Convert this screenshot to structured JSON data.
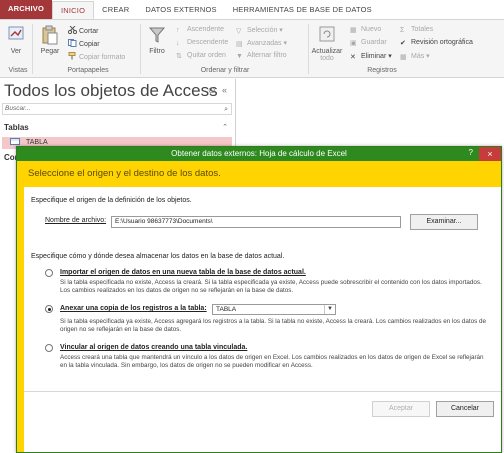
{
  "ribbon_tabs": [
    "ARCHIVO",
    "INICIO",
    "CREAR",
    "DATOS EXTERNOS",
    "HERRAMIENTAS DE BASE DE DATOS"
  ],
  "ribbon": {
    "ver": "Ver",
    "pegar": "Pegar",
    "cortar": "Cortar",
    "copiar": "Copiar",
    "copiar_formato": "Copiar formato",
    "filtro": "Filtro",
    "ascendente": "Ascendente",
    "descendente": "Descendente",
    "quitar_orden": "Quitar orden",
    "seleccion": "Selección",
    "avanzadas": "Avanzadas",
    "alternar_filtro": "Alternar filtro",
    "actualizar": "Actualizar",
    "todo": "todo",
    "nuevo": "Nuevo",
    "guardar": "Guardar",
    "eliminar": "Eliminar",
    "totales": "Totales",
    "revision": "Revisión ortográfica",
    "mas": "Más",
    "groups": [
      "Vistas",
      "Portapapeles",
      "Ordenar y filtrar",
      "Registros"
    ]
  },
  "nav": {
    "title": "Todos los objetos de Access",
    "search_placeholder": "Buscar...",
    "group_tablas": "Tablas",
    "item_tabla": "TABLA",
    "group_consultas": "Consultas"
  },
  "dialog": {
    "title": "Obtener datos externos: Hoja de cálculo de Excel",
    "help": "?",
    "close": "×",
    "header": "Seleccione el origen y el destino de los datos.",
    "specify_source": "Especifique el origen de la definición de los objetos.",
    "file_label": "Nombre de archivo:",
    "file_value": "E:\\Usuario 98637773\\Documents\\",
    "browse": "Examinar...",
    "specify_store": "Especifique cómo y dónde desea almacenar los datos en la base de datos actual.",
    "opt1_label": "Importar el origen de datos en una nueva tabla de la base de datos actual.",
    "opt1_desc": "Si la tabla especificada no existe, Access la creará. Si la tabla especificada ya existe, Access puede sobrescribir el contenido con los datos importados. Los cambios realizados en los datos de origen no se reflejarán en la base de datos.",
    "opt2_label": "Anexar una copia de los registros a la tabla:",
    "opt2_select": "TABLA",
    "opt2_desc": "Si la tabla especificada ya existe, Access agregará los registros a la tabla. Si la tabla no existe, Access la creará. Los cambios realizados en los datos de origen no se reflejarán en la base de datos.",
    "opt3_label": "Vincular al origen de datos creando una tabla vinculada.",
    "opt3_desc": "Access creará una tabla que mantendrá un vínculo a los datos de origen en Excel. Los cambios realizados en los datos de origen de Excel se reflejarán en la tabla vinculada. Sin embargo, los datos de origen no se pueden modificar en Access.",
    "accept": "Aceptar",
    "cancel": "Cancelar"
  }
}
